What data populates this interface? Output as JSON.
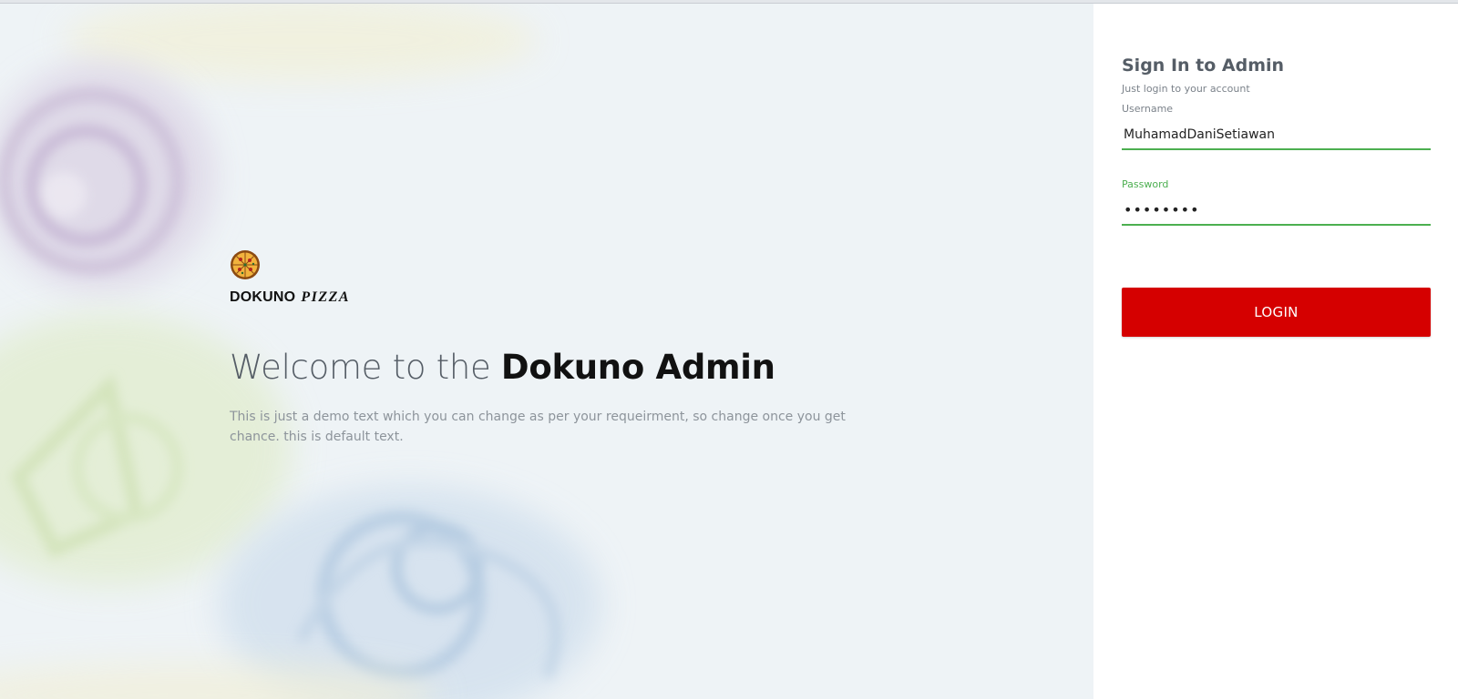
{
  "brand": {
    "name": "DOKUNO",
    "name_script": "PIZZA",
    "logo_icon": "pizza-icon"
  },
  "hero": {
    "welcome_prefix": "Welcome to the",
    "welcome_strong": "Dokuno Admin",
    "intro": "This is just a demo text which you can change as per your requeirment, so change once you get chance. this is default text."
  },
  "login": {
    "title": "Sign In to Admin",
    "subtitle": "Just login to your account",
    "username_label": "Username",
    "username_value": "MuhamadDaniSetiawan",
    "password_label": "Password",
    "password_value": "••••••••",
    "button_label": "LOGIN"
  },
  "colors": {
    "accent_green": "#4caf50",
    "button_red": "#d50000",
    "hero_background": "#eef3f6"
  }
}
